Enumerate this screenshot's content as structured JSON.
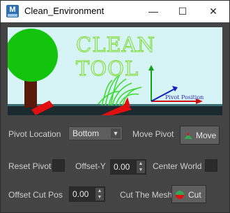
{
  "window": {
    "title": "Clean_Environment",
    "app_icon_letter": "M",
    "minimize": "—",
    "maximize": "☐",
    "close": "✕"
  },
  "banner": {
    "title": "CLEAN TOOL",
    "pivot_caption": "Pivot Position",
    "title_color": "#7bdc2a"
  },
  "pivot": {
    "location_label": "Pivot Location",
    "location_value": "Bottom",
    "move_pivot_label": "Move Pivot",
    "move_button": "Move"
  },
  "reset": {
    "label": "Reset Pivot"
  },
  "offset_y": {
    "label": "Offset-Y",
    "value": "0.00"
  },
  "center_world": {
    "label": "Center World"
  },
  "offset_cut": {
    "label": "Offset Cut Pos",
    "value": "0.00"
  },
  "cut": {
    "label": "Cut The Mesh",
    "button": "Cut"
  },
  "colors": {
    "background": "#444444",
    "accent_green": "#34a853",
    "accent_red": "#e01010"
  }
}
